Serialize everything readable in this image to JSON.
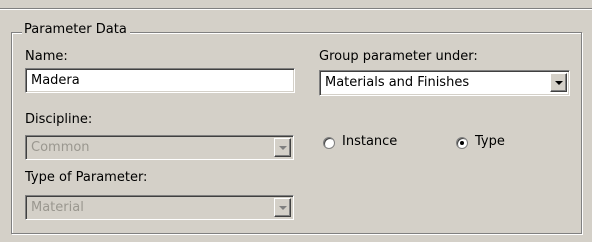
{
  "group": {
    "title": "Parameter Data"
  },
  "name": {
    "label": "Name:",
    "value": "Madera"
  },
  "group_under": {
    "label": "Group parameter under:",
    "selected": "Materials and Finishes"
  },
  "discipline": {
    "label": "Discipline:",
    "selected": "Common",
    "enabled": false
  },
  "type_of_parameter": {
    "label": "Type of Parameter:",
    "selected": "Material",
    "enabled": false
  },
  "parameter_kind": {
    "options": [
      {
        "label": "Instance",
        "selected": false
      },
      {
        "label": "Type",
        "selected": true
      }
    ]
  },
  "icons": {
    "dropdown": "chevron-down-icon",
    "radio": "radio-icon"
  },
  "colors": {
    "window_background": "#d4d0c8",
    "disabled_text": "#9a978f"
  }
}
